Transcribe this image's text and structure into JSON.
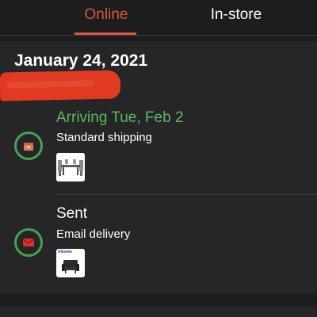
{
  "tabs": [
    {
      "label": "Online",
      "active": true
    },
    {
      "label": "In-store",
      "active": false
    }
  ],
  "order": {
    "date": "January 24, 2021",
    "items": [
      {
        "status": "Arriving Tue, Feb 2",
        "status_color": "#5fb760",
        "method": "Standard shipping",
        "icon": "package-icon",
        "image": "dining-set-thumbnail"
      },
      {
        "status": "Sent",
        "status_color": "#ffffff",
        "method": "Email delivery",
        "icon": "envelope-icon",
        "image": "allstate-protection-thumbnail",
        "image_brand": "Allstate"
      }
    ]
  },
  "colors": {
    "accent": "#e0533e",
    "success": "#4aa24a",
    "background": "#1d1d1f",
    "card": "#262628"
  }
}
